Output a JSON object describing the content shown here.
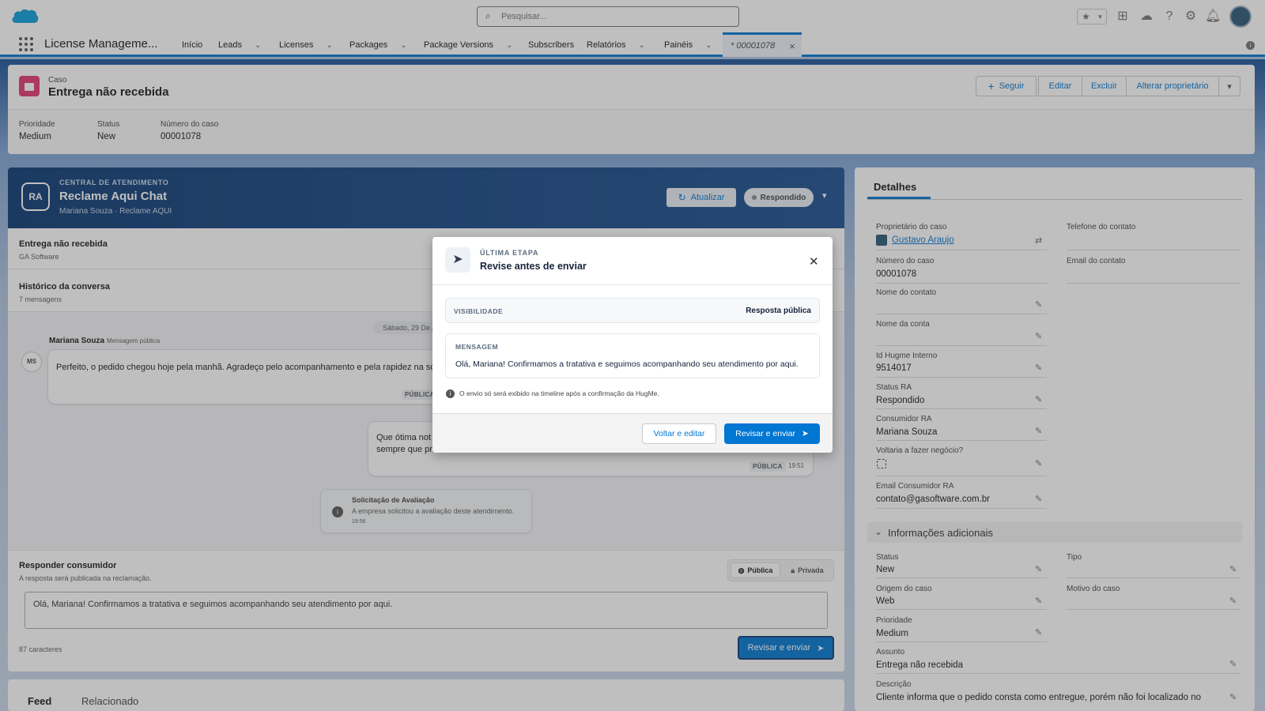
{
  "header": {
    "search_placeholder": "Pesquisar...",
    "app_name": "License Manageme...",
    "nav": [
      {
        "label": "Início"
      },
      {
        "label": "Leads"
      },
      {
        "label": "Licenses"
      },
      {
        "label": "Packages"
      },
      {
        "label": "Package Versions"
      },
      {
        "label": "Subscribers"
      },
      {
        "label": "Relatórios"
      },
      {
        "label": "Painéis"
      }
    ],
    "active_tab": "* 00001078"
  },
  "case": {
    "object_label": "Caso",
    "title": "Entrega não recebida",
    "buttons": {
      "follow": "Seguir",
      "edit": "Editar",
      "delete": "Excluir",
      "change_owner": "Alterar proprietário"
    },
    "highlights": [
      {
        "label": "Prioridade",
        "value": "Medium"
      },
      {
        "label": "Status",
        "value": "New"
      },
      {
        "label": "Número do caso",
        "value": "00001078"
      }
    ]
  },
  "chat": {
    "avatar": "RA",
    "eyebrow": "CENTRAL DE ATENDIMENTO",
    "title": "Reclame Aqui Chat",
    "subtitle": "Mariana Souza · Reclame AQUI",
    "refresh_label": "Atualizar",
    "status_label": "Respondido",
    "complaint_title": "Entrega não recebida",
    "complaint_company": "GA Software",
    "history_title": "Histórico da conversa",
    "history_count": "7 mensagens",
    "date_divider": "Sábado, 29 De Ag",
    "msg1": {
      "avatar": "MS",
      "author": "Mariana Souza",
      "type": "Mensagem pública",
      "text": "Perfeito, o pedido chegou hoje pela manhã. Agradeço pelo acompanhamento e pela rapidez na solu",
      "badge": "PÚBLICA"
    },
    "msg2": {
      "text_line1": "Que ótima not",
      "text_line2": "sempre que pr",
      "badge": "PÚBLICA",
      "time": "19:51"
    },
    "system": {
      "title": "Solicitação de Avaliação",
      "text": "A empresa solicitou a avaliação deste atendimento.",
      "time": "19:56"
    },
    "reply": {
      "title": "Responder consumidor",
      "subtitle": "A resposta será publicada na reclamação.",
      "public_label": "Pública",
      "private_label": "Privada",
      "text": "Olá, Mariana! Confirmamos a tratativa e seguimos acompanhando seu atendimento por aqui.",
      "char_count": "87 caracteres",
      "send_label": "Revisar e enviar"
    }
  },
  "bottom_tabs": {
    "feed": "Feed",
    "related": "Relacionado"
  },
  "details": {
    "tab": "Detalhes",
    "fields": {
      "owner_label": "Proprietário do caso",
      "owner_value": "Gustavo Araujo",
      "phone_label": "Telefone do contato",
      "case_number_label": "Número do caso",
      "case_number_value": "00001078",
      "email_label": "Email do contato",
      "contact_name_label": "Nome do contato",
      "account_name_label": "Nome da conta",
      "hugme_id_label": "Id Hugme Interno",
      "hugme_id_value": "9514017",
      "ra_status_label": "Status RA",
      "ra_status_value": "Respondido",
      "ra_consumer_label": "Consumidor RA",
      "ra_consumer_value": "Mariana Souza",
      "again_label": "Voltaria a fazer negócio?",
      "ra_email_label": "Email Consumidor RA",
      "ra_email_value": "contato@gasoftware.com.br"
    },
    "section_title": "Informações adicionais",
    "additional": {
      "status_label": "Status",
      "status_value": "New",
      "type_label": "Tipo",
      "origin_label": "Origem do caso",
      "origin_value": "Web",
      "reason_label": "Motivo do caso",
      "priority_label": "Prioridade",
      "priority_value": "Medium",
      "subject_label": "Assunto",
      "subject_value": "Entrega não recebida",
      "description_label": "Descrição",
      "description_value": "Cliente informa que o pedido consta como entregue, porém não foi localizado no"
    }
  },
  "modal": {
    "eyebrow": "ÚLTIMA ETAPA",
    "title": "Revise antes de enviar",
    "visibility_label": "VISIBILIDADE",
    "visibility_value": "Resposta pública",
    "message_label": "MENSAGEM",
    "message_text": "Olá, Mariana! Confirmamos a tratativa e seguimos acompanhando seu atendimento por aqui.",
    "note": "O envio só será exibido na timeline após a confirmação da HugMe.",
    "back_label": "Voltar e editar",
    "confirm_label": "Revisar e enviar"
  },
  "colors": {
    "brand": "#0176d3",
    "chat_header": "#0b3a75",
    "case_icon": "#e3386f"
  }
}
